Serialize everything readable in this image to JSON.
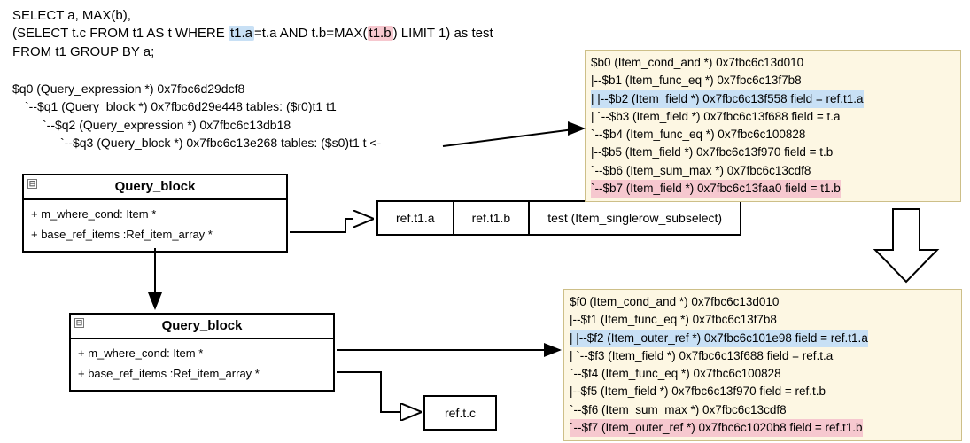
{
  "sql": {
    "line1_a": "SELECT a, MAX(b),",
    "line2_a": "(SELECT t.c FROM t1 AS t WHERE ",
    "line2_hl1": "t1.a",
    "line2_b": "=t.a AND t.b=MAX(",
    "line2_hl2": "t1.b",
    "line2_c": ") LIMIT 1) as test",
    "line3_a": "FROM t1 GROUP BY a;"
  },
  "qtree": {
    "l0": "$q0 (Query_expression *) 0x7fbc6d29dcf8",
    "l1": "`--$q1 (Query_block *) 0x7fbc6d29e448 tables: ($r0)t1 t1",
    "l2": "    `--$q2 (Query_expression *) 0x7fbc6c13db18",
    "l3": "        `--$q3 (Query_block *) 0x7fbc6c13e268 tables: ($s0)t1 t <-"
  },
  "uml1": {
    "title": "Query_block",
    "row1": "+ m_where_cond: Item *",
    "row2": "+ base_ref_items :Ref_item_array *"
  },
  "uml2": {
    "title": "Query_block",
    "row1": "+ m_where_cond: Item *",
    "row2": "+ base_ref_items :Ref_item_array *"
  },
  "cells_top": {
    "c1": "ref.t1.a",
    "c2": "ref.t1.b",
    "c3": "test (Item_singlerow_subselect)"
  },
  "cell_bottom": "ref.t.c",
  "box_top": {
    "r0": "$b0 (Item_cond_and *) 0x7fbc6c13d010",
    "r1": "|--$b1 (Item_func_eq *) 0x7fbc6c13f7b8",
    "r2": "|  |--$b2 (Item_field *) 0x7fbc6c13f558 field = ref.t1.a",
    "r3": "|  `--$b3 (Item_field *) 0x7fbc6c13f688 field = t.a",
    "r4": "`--$b4 (Item_func_eq *) 0x7fbc6c100828",
    "r5": "   |--$b5 (Item_field *) 0x7fbc6c13f970 field = t.b",
    "r6": "   `--$b6 (Item_sum_max *) 0x7fbc6c13cdf8",
    "r7": "      `--$b7 (Item_field *) 0x7fbc6c13faa0 field = t1.b"
  },
  "box_bottom": {
    "r0": "$f0 (Item_cond_and *) 0x7fbc6c13d010",
    "r1": "|--$f1 (Item_func_eq *) 0x7fbc6c13f7b8",
    "r2": "|  |--$f2 (Item_outer_ref *) 0x7fbc6c101e98 field = ref.t1.a",
    "r3": "|  `--$f3 (Item_field *) 0x7fbc6c13f688 field = ref.t.a",
    "r4": "`--$f4 (Item_func_eq *) 0x7fbc6c100828",
    "r5": "   |--$f5 (Item_field *) 0x7fbc6c13f970 field = ref.t.b",
    "r6": "   `--$f6 (Item_sum_max *) 0x7fbc6c13cdf8",
    "r7": "      `--$f7 (Item_outer_ref *) 0x7fbc6c1020b8 field = ref.t1.b"
  },
  "icons": {
    "collapse": "⊟"
  }
}
